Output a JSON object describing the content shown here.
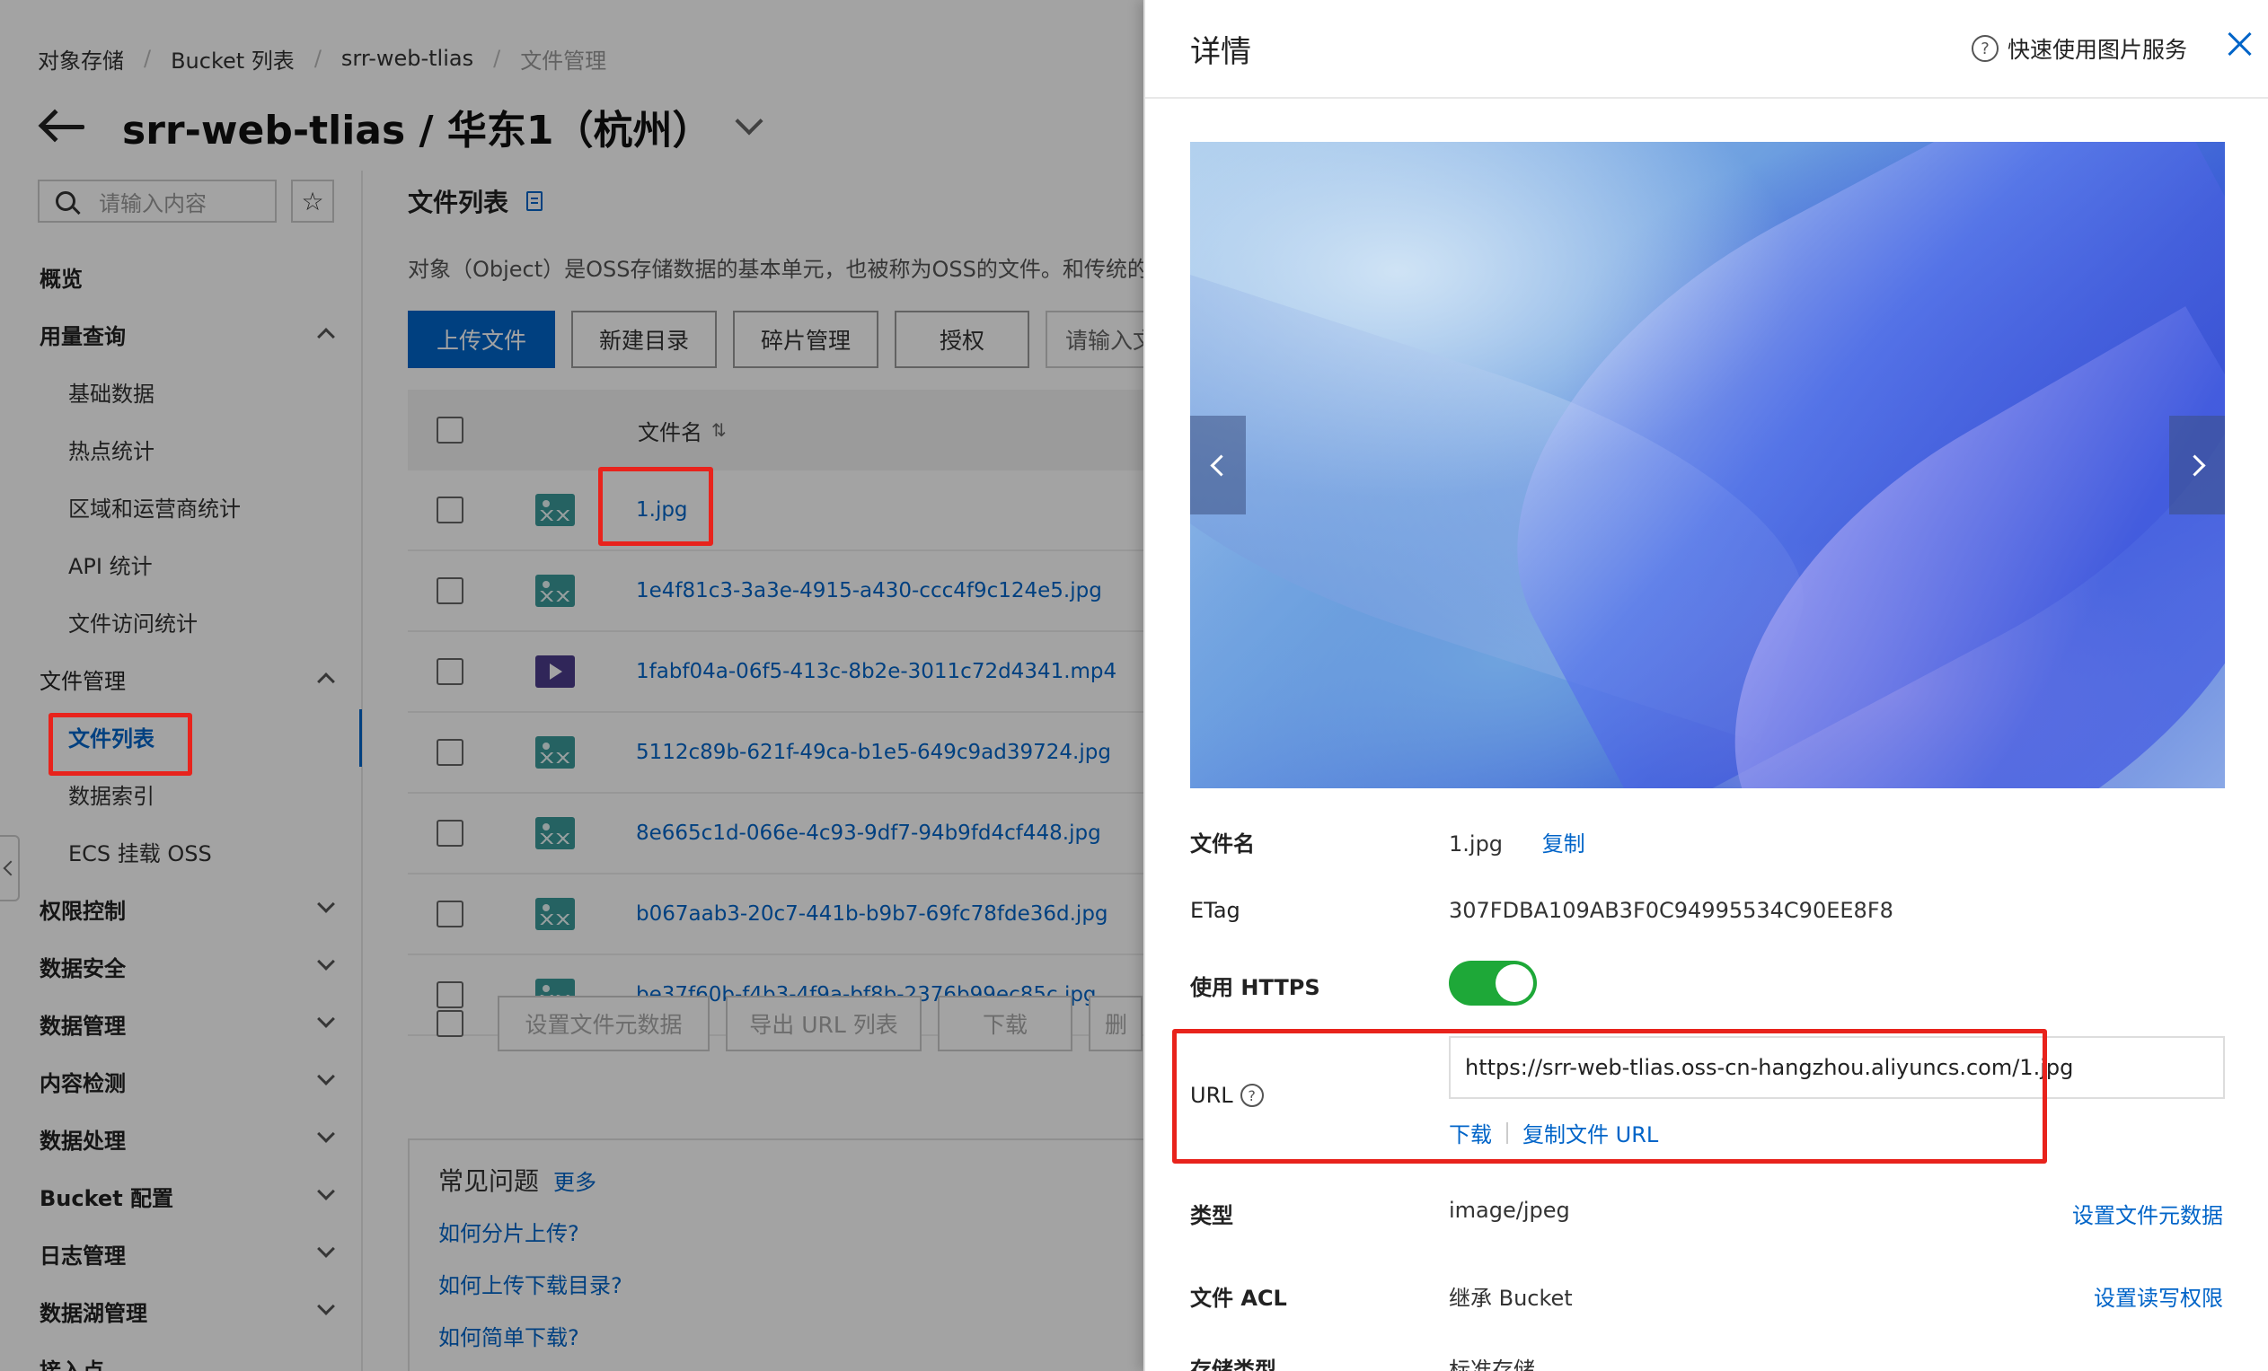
{
  "breadcrumb": [
    "对象存储",
    "Bucket 列表",
    "srr-web-tlias",
    "文件管理"
  ],
  "page_title": "srr-web-tlias / 华东1（杭州）",
  "sidebar": {
    "search_placeholder": "请输入内容",
    "items": [
      {
        "label": "概览"
      },
      {
        "label": "用量查询"
      },
      {
        "label": "基础数据"
      },
      {
        "label": "热点统计"
      },
      {
        "label": "区域和运营商统计"
      },
      {
        "label": "API 统计"
      },
      {
        "label": "文件访问统计"
      },
      {
        "label": "文件管理"
      },
      {
        "label": "文件列表"
      },
      {
        "label": "数据索引"
      },
      {
        "label": "ECS 挂载 OSS"
      },
      {
        "label": "权限控制"
      },
      {
        "label": "数据安全"
      },
      {
        "label": "数据管理"
      },
      {
        "label": "内容检测"
      },
      {
        "label": "数据处理"
      },
      {
        "label": "Bucket 配置"
      },
      {
        "label": "日志管理"
      },
      {
        "label": "数据湖管理"
      },
      {
        "label": "接入点"
      }
    ]
  },
  "main": {
    "section_title": "文件列表",
    "description": "对象（Object）是OSS存储数据的基本单元，也被称为OSS的文件。和传统的文",
    "toolbar": {
      "upload": "上传文件",
      "new_dir": "新建目录",
      "fragments": "碎片管理",
      "authorize": "授权",
      "search_placeholder": "请输入文"
    },
    "table": {
      "col_name": "文件名",
      "rows": [
        {
          "name": "1.jpg",
          "type": "image"
        },
        {
          "name": "1e4f81c3-3a3e-4915-a430-ccc4f9c124e5.jpg",
          "type": "image"
        },
        {
          "name": "1fabf04a-06f5-413c-8b2e-3011c72d4341.mp4",
          "type": "video"
        },
        {
          "name": "5112c89b-621f-49ca-b1e5-649c9ad39724.jpg",
          "type": "image"
        },
        {
          "name": "8e665c1d-066e-4c93-9df7-94b9fd4cf448.jpg",
          "type": "image"
        },
        {
          "name": "b067aab3-20c7-441b-b9b7-69fc78fde36d.jpg",
          "type": "image"
        },
        {
          "name": "be37f60b-f4b3-4f9a-bf8b-2376b99ec85c.jpg",
          "type": "image"
        }
      ]
    },
    "bottom_actions": {
      "set_meta": "设置文件元数据",
      "export_url": "导出 URL 列表",
      "download": "下载",
      "more": "删"
    },
    "faq": {
      "title": "常见问题",
      "more": "更多",
      "links": [
        "如何分片上传?",
        "如何上传下载目录?",
        "如何简单下载?"
      ]
    }
  },
  "drawer": {
    "title": "详情",
    "quick_link": "快速使用图片服务",
    "filename_label": "文件名",
    "filename": "1.jpg",
    "copy": "复制",
    "etag_label": "ETag",
    "etag": "307FDBA109AB3F0C94995534C90EE8F8",
    "https_label": "使用 HTTPS",
    "https_on": true,
    "url_label": "URL",
    "url": "https://srr-web-tlias.oss-cn-hangzhou.aliyuncs.com/1.jpg",
    "download": "下载",
    "copy_url": "复制文件 URL",
    "type_label": "类型",
    "type": "image/jpeg",
    "set_meta": "设置文件元数据",
    "acl_label": "文件 ACL",
    "acl": "继承 Bucket",
    "set_acl": "设置读写权限",
    "storage_label": "存储类型",
    "storage": "标准存储"
  },
  "colors": {
    "accent": "#0064c8",
    "highlight": "#e8231c",
    "toggle_on": "#1ea838"
  }
}
